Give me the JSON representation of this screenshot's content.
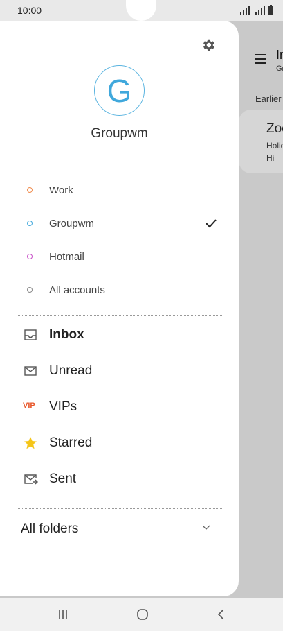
{
  "status_bar": {
    "time": "10:00"
  },
  "background": {
    "title": "Inbox",
    "subtitle": "Groupwm",
    "section": "Earlier",
    "email": {
      "sender": "Zoe",
      "subject": "Holiday",
      "preview": "Hi"
    }
  },
  "drawer": {
    "avatar_letter": "G",
    "account_name": "Groupwm",
    "accounts": [
      {
        "label": "Work",
        "color": "#f08a4b",
        "selected": false
      },
      {
        "label": "Groupwm",
        "color": "#40a8dc",
        "selected": true
      },
      {
        "label": "Hotmail",
        "color": "#c850c8",
        "selected": false
      },
      {
        "label": "All accounts",
        "color": "#888888",
        "selected": false
      }
    ],
    "folders": [
      {
        "label": "Inbox",
        "icon": "inbox-icon",
        "bold": true
      },
      {
        "label": "Unread",
        "icon": "envelope-icon",
        "bold": false
      },
      {
        "label": "VIPs",
        "icon": "vip-icon",
        "badge": "VIP",
        "bold": false
      },
      {
        "label": "Starred",
        "icon": "star-icon",
        "bold": false
      },
      {
        "label": "Sent",
        "icon": "sent-icon",
        "bold": false
      }
    ],
    "all_folders_label": "All folders"
  },
  "colors": {
    "accent": "#40a8dc",
    "vip": "#e8572b",
    "star": "#f5c518"
  }
}
